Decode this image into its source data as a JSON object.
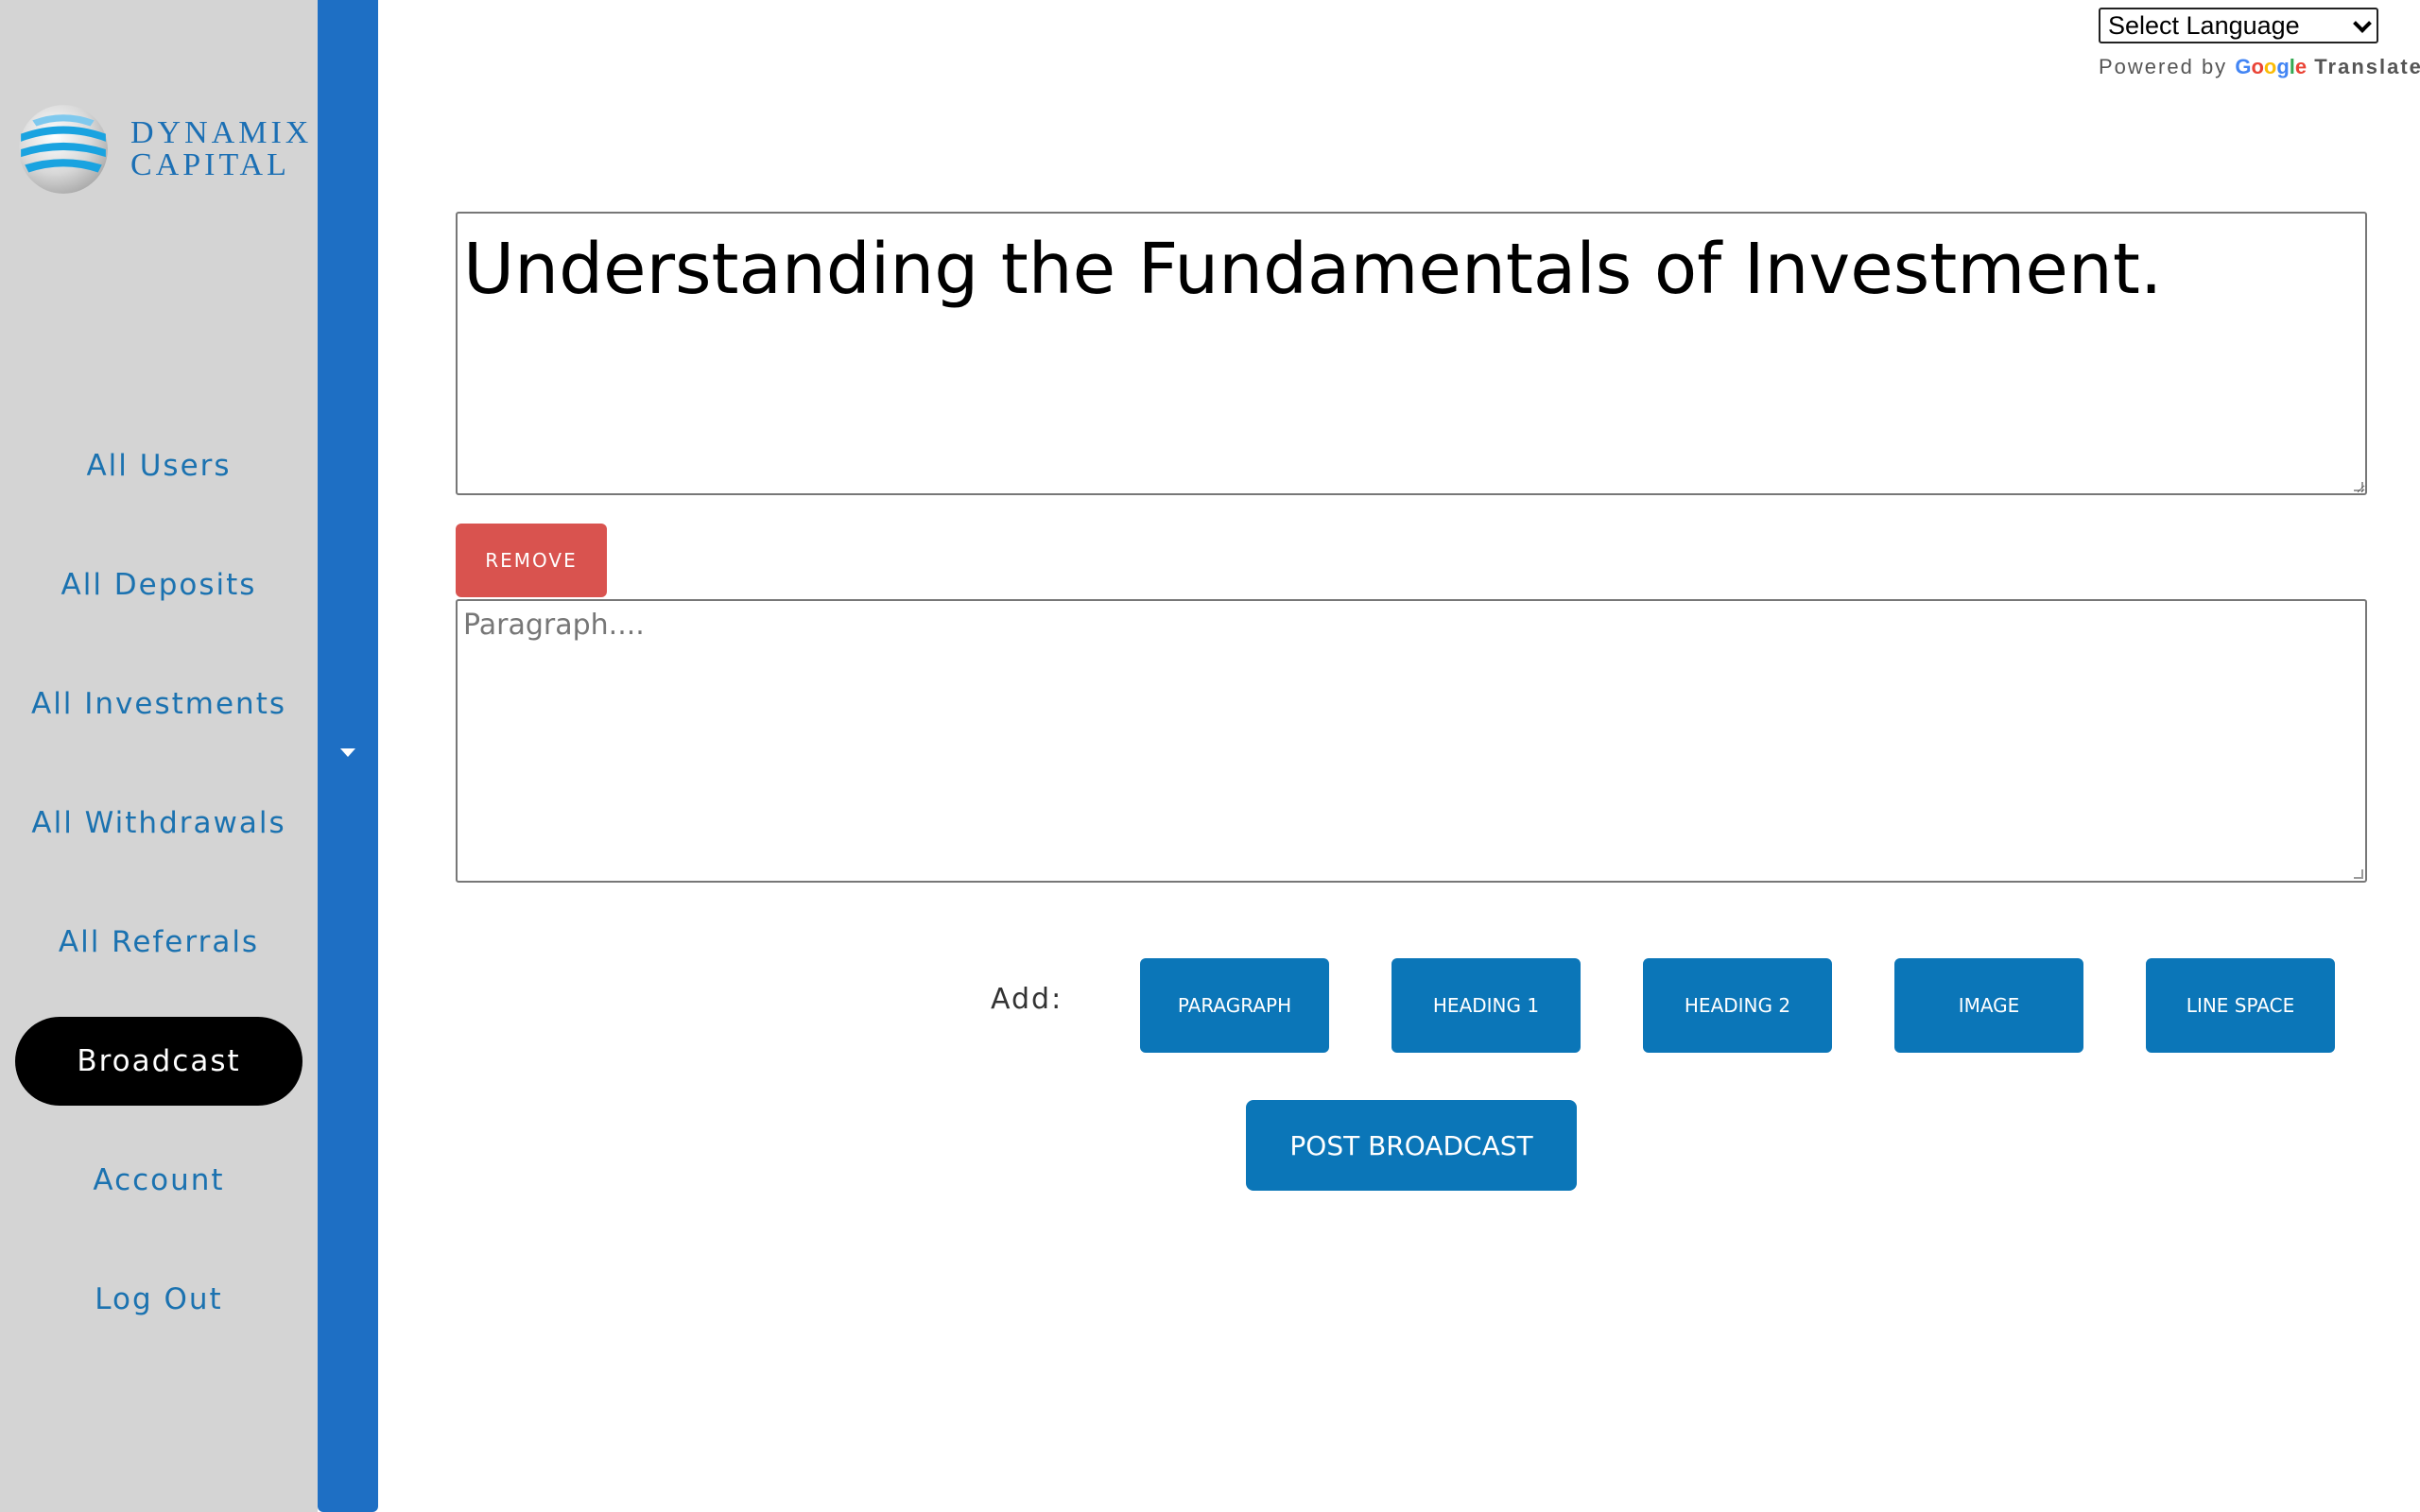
{
  "brand": {
    "line1": "DYNAMIX",
    "line2": "CAPITAL"
  },
  "sidebar": {
    "items": [
      {
        "label": "All Users"
      },
      {
        "label": "All Deposits"
      },
      {
        "label": "All Investments"
      },
      {
        "label": "All Withdrawals"
      },
      {
        "label": "All Referrals"
      },
      {
        "label": "Broadcast",
        "active": true
      },
      {
        "label": "Account"
      },
      {
        "label": "Log Out"
      }
    ]
  },
  "translate": {
    "select_value": "Select Language",
    "powered_by": "Powered by",
    "google": "Google",
    "translate": "Translate"
  },
  "editor": {
    "heading_value": "Understanding the Fundamentals of Investment.",
    "remove_label": "REMOVE",
    "paragraph_placeholder": "Paragraph....",
    "add_label": "Add:",
    "add_buttons": [
      "PARAGRAPH",
      "HEADING 1",
      "HEADING 2",
      "IMAGE",
      "LINE SPACE"
    ],
    "post_label": "POST BROADCAST"
  },
  "colors": {
    "sidebar_bg": "#d4d4d4",
    "accent_strip": "#1e6fc4",
    "nav_text": "#1b72b0",
    "active_bg": "#000000",
    "button_blue": "#0b76b8",
    "remove_red": "#d9534f"
  }
}
